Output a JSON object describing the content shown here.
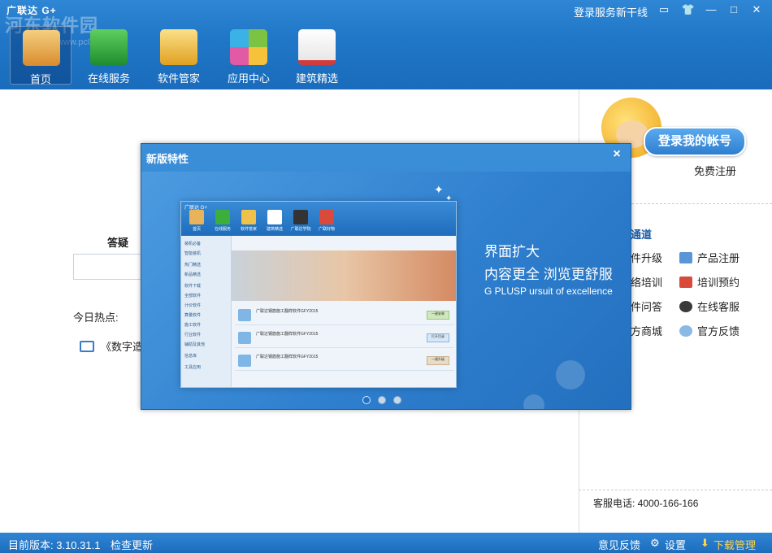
{
  "window": {
    "title": "广联达 G+",
    "watermark": "河东软件园",
    "watermark_url": "www.pc0359.cn",
    "login_service_link": "登录服务新干线",
    "controls": [
      "message-icon",
      "shirt-icon",
      "minimize-icon",
      "maximize-icon",
      "close-icon"
    ]
  },
  "nav": {
    "items": [
      {
        "label": "首页",
        "icon": "home-icon",
        "color": "#e8b35a"
      },
      {
        "label": "在线服务",
        "icon": "people-icon",
        "color": "#3cae3c"
      },
      {
        "label": "软件管家",
        "icon": "software-box-icon",
        "color": "#f0c24c"
      },
      {
        "label": "应用中心",
        "icon": "app-grid-icon",
        "color": "#7cc243"
      },
      {
        "label": "建筑精选",
        "icon": "book-icon",
        "color": "#e25a5a"
      }
    ]
  },
  "main": {
    "qa_label": "答疑",
    "hot_label": "今日热点:",
    "hot_item": "《数字造价"
  },
  "right_panel": {
    "login_button": "登录我的帐号",
    "free_register": "免费注册",
    "channel_title": "通道",
    "links": [
      {
        "label": "件升级"
      },
      {
        "label": "产品注册"
      },
      {
        "label": "络培训"
      },
      {
        "label": "培训预约"
      },
      {
        "label": "件问答"
      },
      {
        "label": "在线客服"
      },
      {
        "label": "方商城"
      },
      {
        "label": "官方反馈"
      }
    ],
    "hotline": "客服电话: 4000-166-166"
  },
  "statusbar": {
    "version": "目前版本: 3.10.31.1",
    "check_update": "检查更新",
    "feedback": "意见反馈",
    "settings": "设置",
    "download_manager": "下载管理"
  },
  "modal": {
    "title": "新版特性",
    "close": "×",
    "feature_line1": "界面扩大",
    "feature_line2": "内容更全 浏览更舒服",
    "feature_line3": "G PLUSP  ursuit of excellence",
    "slides": 3,
    "active_slide": 1,
    "preview": {
      "title": "广联达 G+",
      "nav": [
        "首页",
        "在线服务",
        "软件管家",
        "建筑精选",
        "广联达学院",
        "广联好物"
      ],
      "side": [
        "装机必备",
        "智能装机",
        "热门精选",
        "新品精选",
        "软件下载",
        "全部软件",
        "计价软件",
        "算量软件",
        "施工软件",
        "行业软件",
        "辅助及其他",
        "信息库",
        "工具应用"
      ],
      "rows": [
        "广联达钢筋施工翻样软件GFY2015",
        "广联达钢筋施工翻样软件GFY2015",
        "广联达钢筋施工翻样软件GFY2015"
      ],
      "row_buttons": [
        "一键安装",
        "打开目录",
        "一键升级"
      ]
    }
  }
}
